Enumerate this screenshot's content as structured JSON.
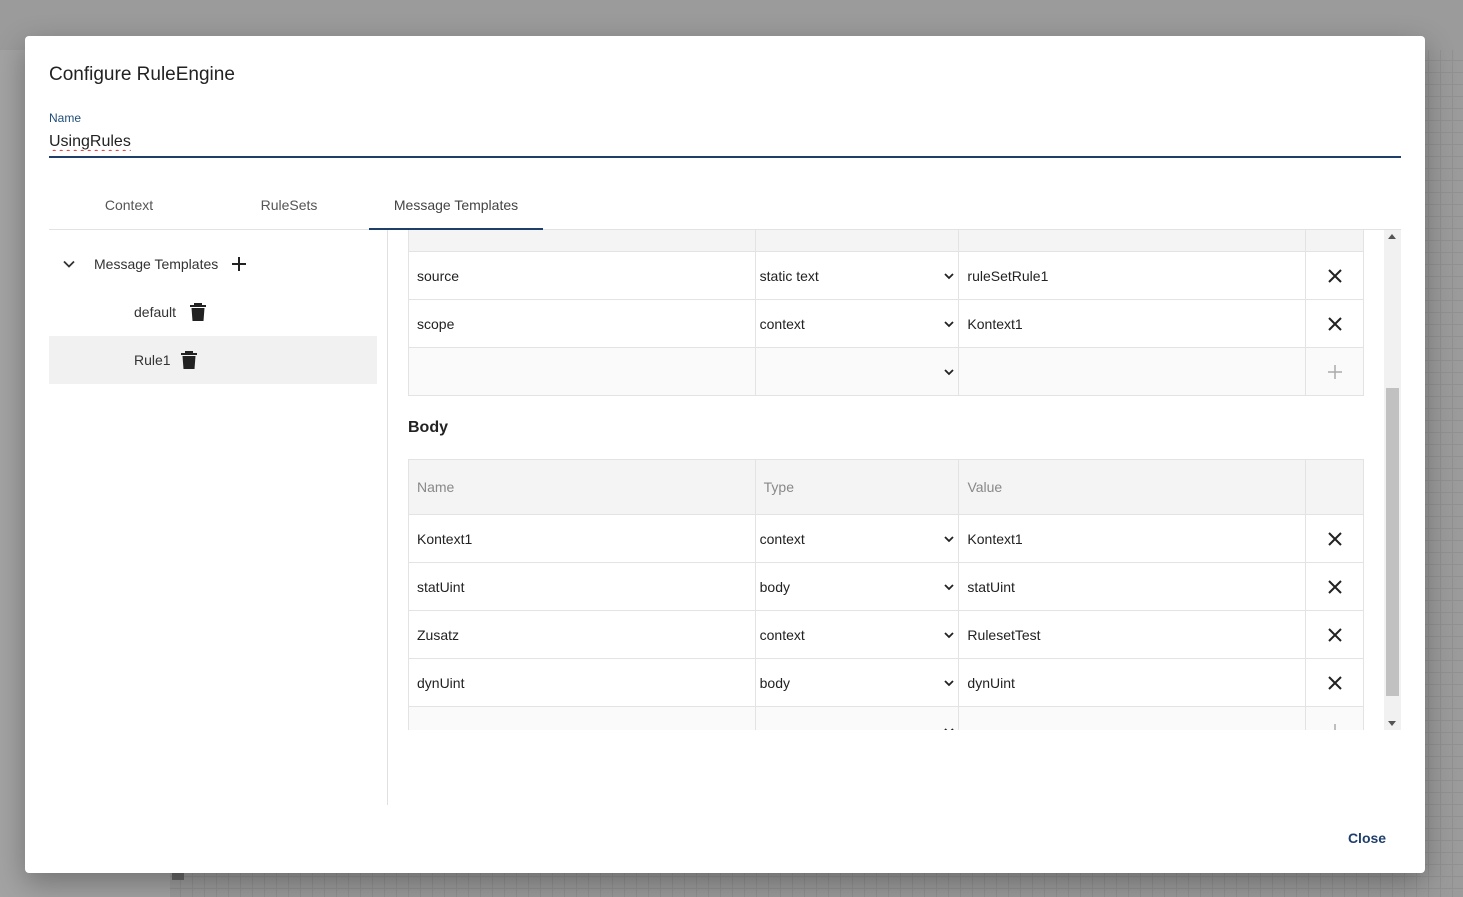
{
  "dialog": {
    "title": "Configure RuleEngine",
    "name_label": "Name",
    "name_value": "UsingRules",
    "close_label": "Close"
  },
  "tabs": [
    {
      "label": "Context"
    },
    {
      "label": "RuleSets"
    },
    {
      "label": "Message Templates"
    }
  ],
  "tree": {
    "root_label": "Message Templates",
    "children": [
      {
        "label": "default"
      },
      {
        "label": "Rule1"
      }
    ]
  },
  "header_table": {
    "rows": [
      {
        "name": "source",
        "type": "static text",
        "value": "ruleSetRule1"
      },
      {
        "name": "scope",
        "type": "context",
        "value": "Kontext1"
      }
    ]
  },
  "body_section": {
    "heading": "Body",
    "columns": {
      "name": "Name",
      "type": "Type",
      "value": "Value"
    },
    "rows": [
      {
        "name": "Kontext1",
        "type": "context",
        "value": "Kontext1"
      },
      {
        "name": "statUint",
        "type": "body",
        "value": "statUint"
      },
      {
        "name": "Zusatz",
        "type": "context",
        "value": "RulesetTest"
      },
      {
        "name": "dynUint",
        "type": "body",
        "value": "dynUint"
      }
    ]
  },
  "colors": {
    "accent": "#1f3f6b",
    "selected_bg": "#f1f1f1"
  }
}
